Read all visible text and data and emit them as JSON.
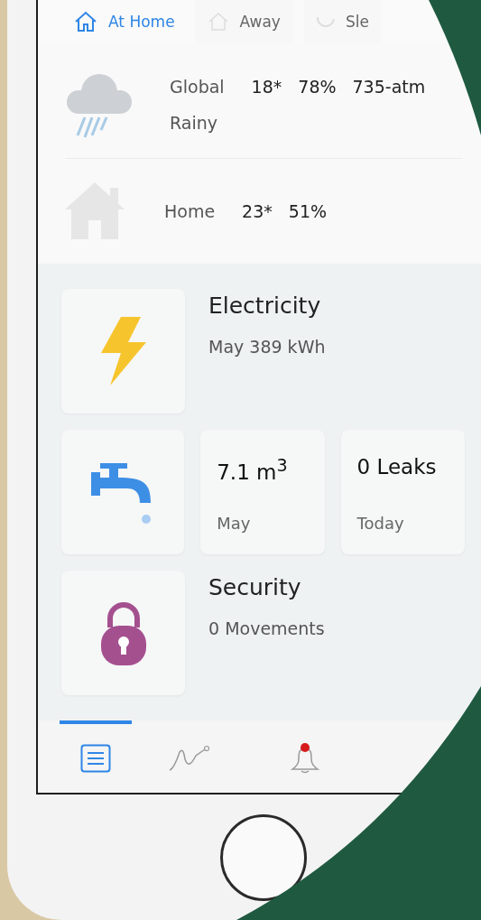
{
  "modes": [
    {
      "label": "At Home",
      "kind": "home",
      "selected": true
    },
    {
      "label": "Away",
      "kind": "away",
      "selected": false
    },
    {
      "label": "Sle",
      "kind": "sleep",
      "selected": false
    }
  ],
  "weather": [
    {
      "kind": "rain",
      "place": "Global",
      "values": [
        "18*",
        "78%",
        "735-atm"
      ],
      "condition": "Rainy"
    },
    {
      "kind": "house",
      "place": "Home",
      "values": [
        "23*",
        "51%"
      ]
    }
  ],
  "electricity": {
    "title": "Electricity",
    "detail": "May 389 kWh"
  },
  "water": {
    "volume": "7.1 m$^{3}$",
    "volume_caption": "May",
    "leaks": "0 Leaks",
    "leaks_caption": "Today"
  },
  "security": {
    "title": "Security",
    "detail": "0 Movements"
  },
  "nav": [
    {
      "kind": "list",
      "selected": true,
      "unread": false
    },
    {
      "kind": "chart",
      "selected": false,
      "unread": false
    },
    {
      "kind": "bell",
      "selected": false,
      "unread": true
    }
  ]
}
